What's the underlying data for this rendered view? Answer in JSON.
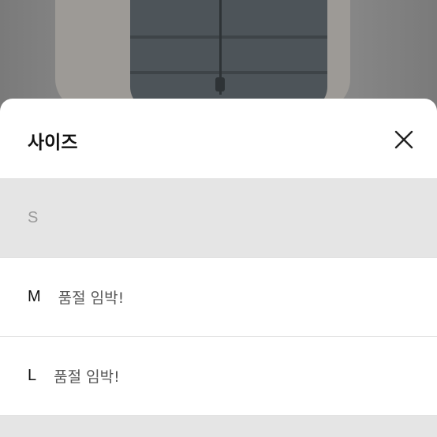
{
  "sheet": {
    "title": "사이즈",
    "close_icon": "close-icon"
  },
  "options": [
    {
      "size": "S",
      "stock": "",
      "disabled": true
    },
    {
      "size": "M",
      "stock": "품절 임박!",
      "disabled": false
    },
    {
      "size": "L",
      "stock": "품절 임박!",
      "disabled": false
    }
  ],
  "colors": {
    "overlay": "#8a8a8a",
    "sheet_bg": "#ffffff",
    "disabled_bg": "#e5e5e5",
    "disabled_text": "#9a9a9a"
  }
}
